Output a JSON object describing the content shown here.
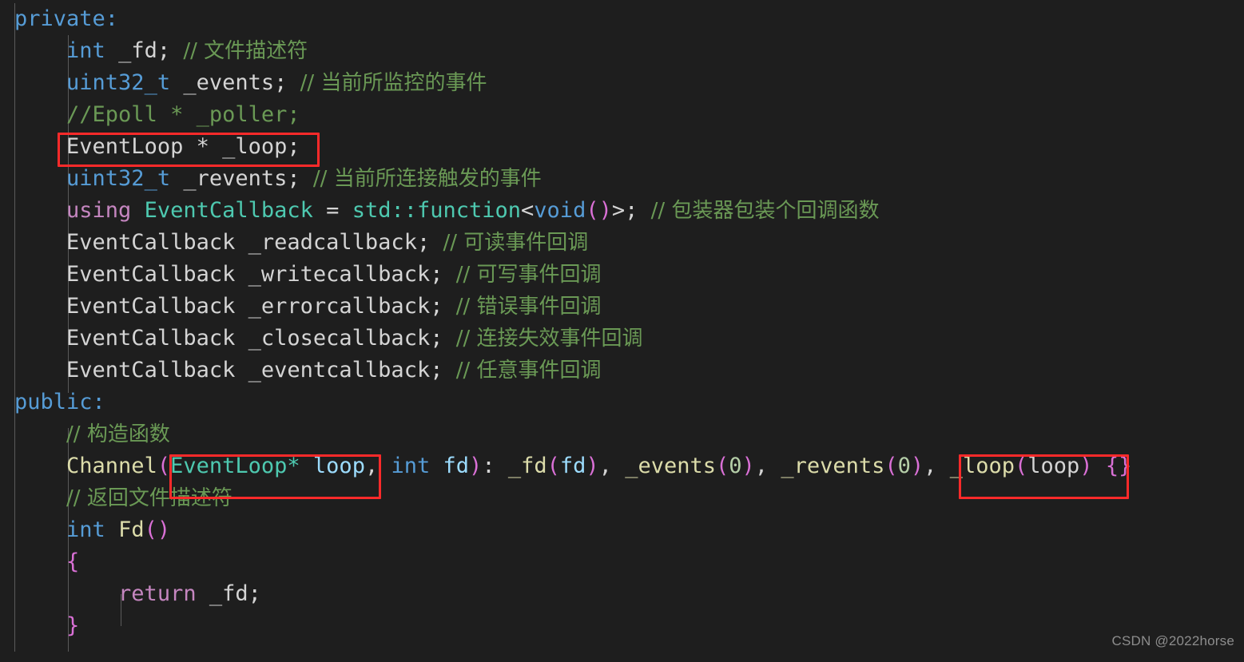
{
  "editor": {
    "background_color": "#1e1e1e",
    "default_text_color": "#d4d4d4",
    "language": "cpp",
    "theme": "dark-plus"
  },
  "colors": {
    "keyword": "#569cd6",
    "control_keyword": "#c586c0",
    "type": "#4ec9b0",
    "function": "#dcdcaa",
    "variable": "#9cdcfe",
    "comment": "#6a9955",
    "number": "#b5cea8",
    "bracket_pink": "#da70d6",
    "plain": "#d4d4d4",
    "annotation_box": "#fc2a2a",
    "watermark": "#8d8d8d"
  },
  "lines": [
    {
      "id": "line-private",
      "text": "private:"
    },
    {
      "id": "line-fd",
      "text": "    int _fd; // 文件描述符"
    },
    {
      "id": "line-events",
      "text": "    uint32_t _events; // 当前所监控的事件"
    },
    {
      "id": "line-epoll-comment",
      "text": "    //Epoll * _poller;"
    },
    {
      "id": "line-loop-member",
      "text": "    EventLoop * _loop;"
    },
    {
      "id": "line-revents",
      "text": "    uint32_t _revents; // 当前所连接触发的事件"
    },
    {
      "id": "line-using",
      "text": "    using EventCallback = std::function<void()>; // 包装器包装个回调函数"
    },
    {
      "id": "line-readcallback",
      "text": "    EventCallback _readcallback; // 可读事件回调"
    },
    {
      "id": "line-writecallback",
      "text": "    EventCallback _writecallback; // 可写事件回调"
    },
    {
      "id": "line-errorcallback",
      "text": "    EventCallback _errorcallback; // 错误事件回调"
    },
    {
      "id": "line-closecallback",
      "text": "    EventCallback _closecallback; // 连接失效事件回调"
    },
    {
      "id": "line-eventcallback",
      "text": "    EventCallback _eventcallback; // 任意事件回调"
    },
    {
      "id": "line-public",
      "text": "public:"
    },
    {
      "id": "line-ctor-comment",
      "text": "    // 构造函数"
    },
    {
      "id": "line-ctor",
      "text": "    Channel(EventLoop* loop, int fd): _fd(fd), _events(0), _revents(0), _loop(loop) {}"
    },
    {
      "id": "line-fd-comment",
      "text": "    // 返回文件描述符"
    },
    {
      "id": "line-fd-signature",
      "text": "    int Fd()"
    },
    {
      "id": "line-open-brace",
      "text": "    {"
    },
    {
      "id": "line-return",
      "text": "        return _fd;"
    },
    {
      "id": "line-close-brace",
      "text": "    }"
    }
  ],
  "tokens": {
    "private": "private:",
    "public": "public:",
    "int": "int",
    "uint32_t": "uint32_t",
    "void": "void",
    "using": "using",
    "return": "return",
    "EventLoop": "EventLoop",
    "EventLoopPtr": "EventLoop*",
    "EventCallback": "EventCallback",
    "std_function": "std::function",
    "Channel": "Channel",
    "Fd": "Fd",
    "_fd": "_fd",
    "_events": "_events",
    "_revents": "_revents",
    "_loop": "_loop",
    "_poller_comment": "//Epoll * _poller;",
    "_readcallback": "_readcallback",
    "_writecallback": "_writecallback",
    "_errorcallback": "_errorcallback",
    "_closecallback": "_closecallback",
    "_eventcallback": "_eventcallback",
    "loop": "loop",
    "fd": "fd",
    "zero": "0",
    "star": "*",
    "semicolon": ";",
    "comma": ",",
    "colon": ":",
    "equals": "=",
    "lt": "<",
    "gt": ">",
    "lparen": "(",
    "rparen": ")",
    "lbrace": "{",
    "rbrace": "}",
    "empty_body": "{}",
    "slashes": "//"
  },
  "comments": {
    "fd": "// 文件描述符",
    "events": "// 当前所监控的事件",
    "revents": "// 当前所连接触发的事件",
    "using": "// 包装器包装个回调函数",
    "read": "// 可读事件回调",
    "write": "// 可写事件回调",
    "error": "// 错误事件回调",
    "close": "// 连接失效事件回调",
    "event": "// 任意事件回调",
    "constructor": "// 构造函数",
    "return_fd": "// 返回文件描述符"
  },
  "annotations": [
    {
      "id": "box-loop-member",
      "label": "EventLoop * _loop;"
    },
    {
      "id": "box-ctor-param",
      "label": "EventLoop* loop,"
    },
    {
      "id": "box-ctor-init",
      "label": "_loop(loop)"
    }
  ],
  "watermark": {
    "text": "CSDN @2022horse"
  }
}
